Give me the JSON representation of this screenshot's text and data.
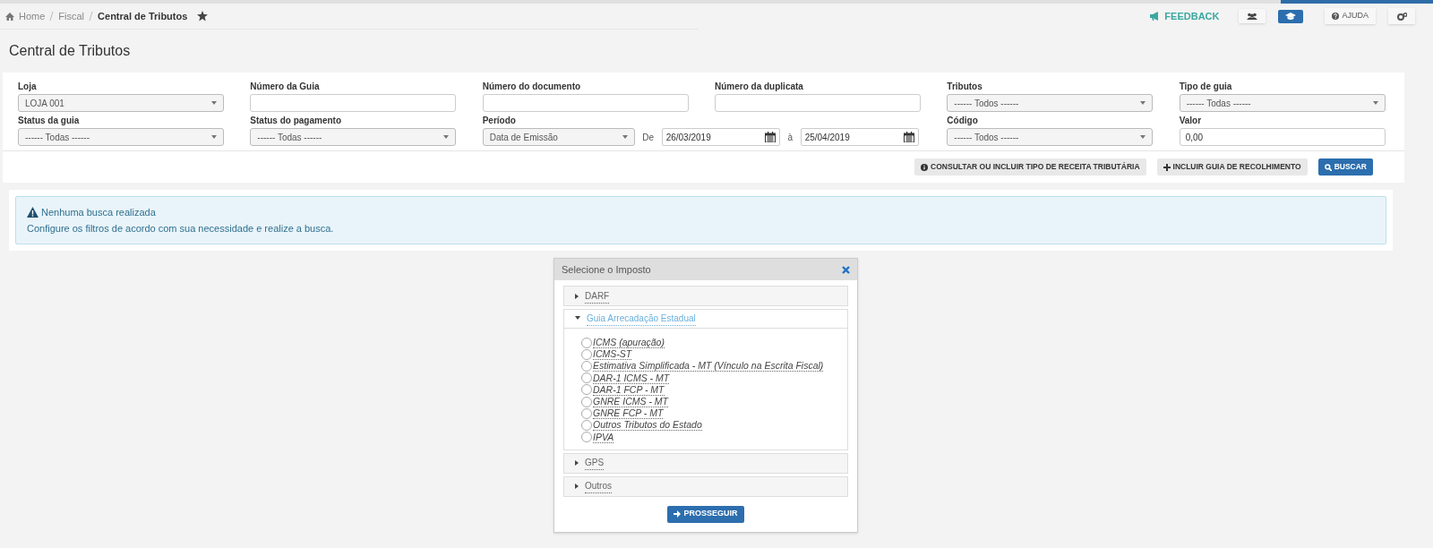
{
  "breadcrumb": [
    {
      "label": "Home",
      "current": false
    },
    {
      "label": "Fiscal",
      "current": false
    },
    {
      "label": "Central de Tributos",
      "current": true
    }
  ],
  "toolbar": {
    "feedback": "FEEDBACK",
    "help": "AJUDA"
  },
  "page_title": "Central de Tributos",
  "filters": [
    {
      "kind": "select",
      "label": "Loja",
      "value": "LOJA 001"
    },
    {
      "kind": "text",
      "label": "Número da Guia"
    },
    {
      "kind": "text",
      "label": "Número do documento"
    },
    {
      "kind": "text",
      "label": "Número da duplicata"
    },
    {
      "kind": "select",
      "label": "Tributos",
      "value": "------ Todos ------"
    },
    {
      "kind": "select",
      "label": "Tipo de guia",
      "value": "------ Todas ------"
    },
    {
      "kind": "select",
      "label": "Status da guia",
      "value": "------ Todas ------"
    },
    {
      "kind": "select",
      "label": "Status do pagamento",
      "value": "------ Todas ------"
    },
    {
      "kind": "period",
      "label": "Período",
      "value": "Data de Emissão",
      "from_label": "De",
      "from": "26/03/2019",
      "to_label": "à",
      "to": "25/04/2019"
    },
    {
      "kind": "select",
      "label": "Código",
      "value": "------ Todos ------"
    },
    {
      "kind": "text",
      "label": "Valor",
      "value": "0,00"
    }
  ],
  "actions": [
    {
      "label": "CONSULTAR OU INCLUIR TIPO DE RECEITA TRIBUTÁRIA",
      "primary": false
    },
    {
      "label": "INCLUIR GUIA DE RECOLHIMENTO",
      "primary": false
    },
    {
      "label": "BUSCAR",
      "primary": true
    }
  ],
  "alert": {
    "title": "Nenhuma busca realizada",
    "message": "Configure os filtros de acordo com sua necessidade e realize a busca."
  },
  "dialog": {
    "title": "Selecione o Imposto",
    "groups": [
      {
        "label": "DARF",
        "expanded": false
      },
      {
        "label": "Guia Arrecadação Estadual",
        "expanded": true,
        "options": [
          {
            "label": "ICMS (apuração)",
            "selected": false
          },
          {
            "label": "ICMS-ST",
            "selected": false
          },
          {
            "label": "Estimativa Simplificada - MT (Vínculo na Escrita Fiscal)",
            "selected": false
          },
          {
            "label": "DAR-1 ICMS - MT",
            "selected": false
          },
          {
            "label": "DAR-1 FCP - MT",
            "selected": false
          },
          {
            "label": "GNRE ICMS - MT",
            "selected": false
          },
          {
            "label": "GNRE FCP - MT",
            "selected": false
          },
          {
            "label": "Outros Tributos do Estado",
            "selected": false
          },
          {
            "label": "IPVA",
            "selected": false
          }
        ]
      },
      {
        "label": "GPS",
        "expanded": false
      },
      {
        "label": "Outros",
        "expanded": false
      }
    ],
    "button": "PROSSEGUIR"
  }
}
